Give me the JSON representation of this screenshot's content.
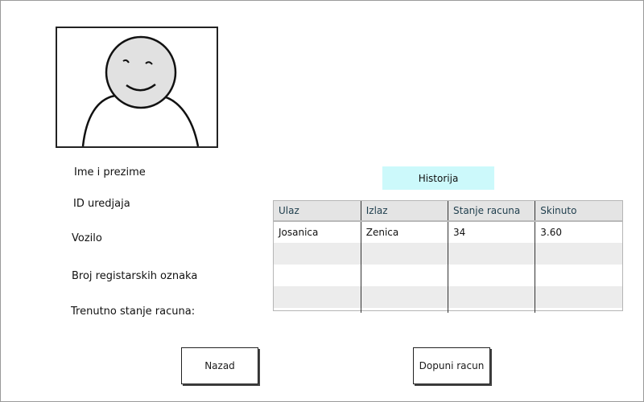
{
  "profile": {
    "labels": {
      "name": "Ime i prezime",
      "device_id": "ID uredjaja",
      "vehicle": "Vozilo",
      "plates": "Broj registarskih oznaka",
      "balance": "Trenutno stanje racuna:"
    },
    "avatar_icon": "user-avatar-placeholder"
  },
  "history": {
    "button_label": "Historija",
    "accent": "#ccf9fb",
    "columns": [
      "Ulaz",
      "Izlaz",
      "Stanje racuna",
      "Skinuto"
    ],
    "rows": [
      [
        "Josanica",
        "Zenica",
        "34",
        "3.60"
      ],
      [
        "",
        "",
        "",
        ""
      ],
      [
        "",
        "",
        "",
        ""
      ],
      [
        "",
        "",
        "",
        ""
      ],
      [
        "",
        "",
        "",
        ""
      ]
    ]
  },
  "actions": {
    "back_label": "Nazad",
    "topup_label": "Dopuni racun"
  }
}
